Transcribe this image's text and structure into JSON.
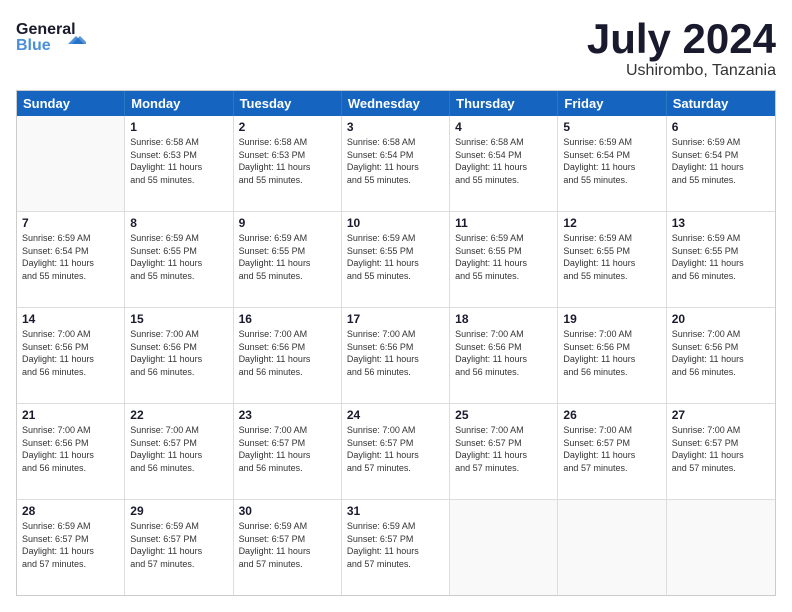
{
  "header": {
    "logo_line1": "General",
    "logo_line2": "Blue",
    "month_year": "July 2024",
    "location": "Ushirombo, Tanzania"
  },
  "calendar": {
    "days_of_week": [
      "Sunday",
      "Monday",
      "Tuesday",
      "Wednesday",
      "Thursday",
      "Friday",
      "Saturday"
    ],
    "weeks": [
      [
        {
          "day": "",
          "info": ""
        },
        {
          "day": "1",
          "info": "Sunrise: 6:58 AM\nSunset: 6:53 PM\nDaylight: 11 hours\nand 55 minutes."
        },
        {
          "day": "2",
          "info": "Sunrise: 6:58 AM\nSunset: 6:53 PM\nDaylight: 11 hours\nand 55 minutes."
        },
        {
          "day": "3",
          "info": "Sunrise: 6:58 AM\nSunset: 6:54 PM\nDaylight: 11 hours\nand 55 minutes."
        },
        {
          "day": "4",
          "info": "Sunrise: 6:58 AM\nSunset: 6:54 PM\nDaylight: 11 hours\nand 55 minutes."
        },
        {
          "day": "5",
          "info": "Sunrise: 6:59 AM\nSunset: 6:54 PM\nDaylight: 11 hours\nand 55 minutes."
        },
        {
          "day": "6",
          "info": "Sunrise: 6:59 AM\nSunset: 6:54 PM\nDaylight: 11 hours\nand 55 minutes."
        }
      ],
      [
        {
          "day": "7",
          "info": "Sunrise: 6:59 AM\nSunset: 6:54 PM\nDaylight: 11 hours\nand 55 minutes."
        },
        {
          "day": "8",
          "info": "Sunrise: 6:59 AM\nSunset: 6:55 PM\nDaylight: 11 hours\nand 55 minutes."
        },
        {
          "day": "9",
          "info": "Sunrise: 6:59 AM\nSunset: 6:55 PM\nDaylight: 11 hours\nand 55 minutes."
        },
        {
          "day": "10",
          "info": "Sunrise: 6:59 AM\nSunset: 6:55 PM\nDaylight: 11 hours\nand 55 minutes."
        },
        {
          "day": "11",
          "info": "Sunrise: 6:59 AM\nSunset: 6:55 PM\nDaylight: 11 hours\nand 55 minutes."
        },
        {
          "day": "12",
          "info": "Sunrise: 6:59 AM\nSunset: 6:55 PM\nDaylight: 11 hours\nand 55 minutes."
        },
        {
          "day": "13",
          "info": "Sunrise: 6:59 AM\nSunset: 6:55 PM\nDaylight: 11 hours\nand 56 minutes."
        }
      ],
      [
        {
          "day": "14",
          "info": "Sunrise: 7:00 AM\nSunset: 6:56 PM\nDaylight: 11 hours\nand 56 minutes."
        },
        {
          "day": "15",
          "info": "Sunrise: 7:00 AM\nSunset: 6:56 PM\nDaylight: 11 hours\nand 56 minutes."
        },
        {
          "day": "16",
          "info": "Sunrise: 7:00 AM\nSunset: 6:56 PM\nDaylight: 11 hours\nand 56 minutes."
        },
        {
          "day": "17",
          "info": "Sunrise: 7:00 AM\nSunset: 6:56 PM\nDaylight: 11 hours\nand 56 minutes."
        },
        {
          "day": "18",
          "info": "Sunrise: 7:00 AM\nSunset: 6:56 PM\nDaylight: 11 hours\nand 56 minutes."
        },
        {
          "day": "19",
          "info": "Sunrise: 7:00 AM\nSunset: 6:56 PM\nDaylight: 11 hours\nand 56 minutes."
        },
        {
          "day": "20",
          "info": "Sunrise: 7:00 AM\nSunset: 6:56 PM\nDaylight: 11 hours\nand 56 minutes."
        }
      ],
      [
        {
          "day": "21",
          "info": "Sunrise: 7:00 AM\nSunset: 6:56 PM\nDaylight: 11 hours\nand 56 minutes."
        },
        {
          "day": "22",
          "info": "Sunrise: 7:00 AM\nSunset: 6:57 PM\nDaylight: 11 hours\nand 56 minutes."
        },
        {
          "day": "23",
          "info": "Sunrise: 7:00 AM\nSunset: 6:57 PM\nDaylight: 11 hours\nand 56 minutes."
        },
        {
          "day": "24",
          "info": "Sunrise: 7:00 AM\nSunset: 6:57 PM\nDaylight: 11 hours\nand 57 minutes."
        },
        {
          "day": "25",
          "info": "Sunrise: 7:00 AM\nSunset: 6:57 PM\nDaylight: 11 hours\nand 57 minutes."
        },
        {
          "day": "26",
          "info": "Sunrise: 7:00 AM\nSunset: 6:57 PM\nDaylight: 11 hours\nand 57 minutes."
        },
        {
          "day": "27",
          "info": "Sunrise: 7:00 AM\nSunset: 6:57 PM\nDaylight: 11 hours\nand 57 minutes."
        }
      ],
      [
        {
          "day": "28",
          "info": "Sunrise: 6:59 AM\nSunset: 6:57 PM\nDaylight: 11 hours\nand 57 minutes."
        },
        {
          "day": "29",
          "info": "Sunrise: 6:59 AM\nSunset: 6:57 PM\nDaylight: 11 hours\nand 57 minutes."
        },
        {
          "day": "30",
          "info": "Sunrise: 6:59 AM\nSunset: 6:57 PM\nDaylight: 11 hours\nand 57 minutes."
        },
        {
          "day": "31",
          "info": "Sunrise: 6:59 AM\nSunset: 6:57 PM\nDaylight: 11 hours\nand 57 minutes."
        },
        {
          "day": "",
          "info": ""
        },
        {
          "day": "",
          "info": ""
        },
        {
          "day": "",
          "info": ""
        }
      ]
    ]
  }
}
